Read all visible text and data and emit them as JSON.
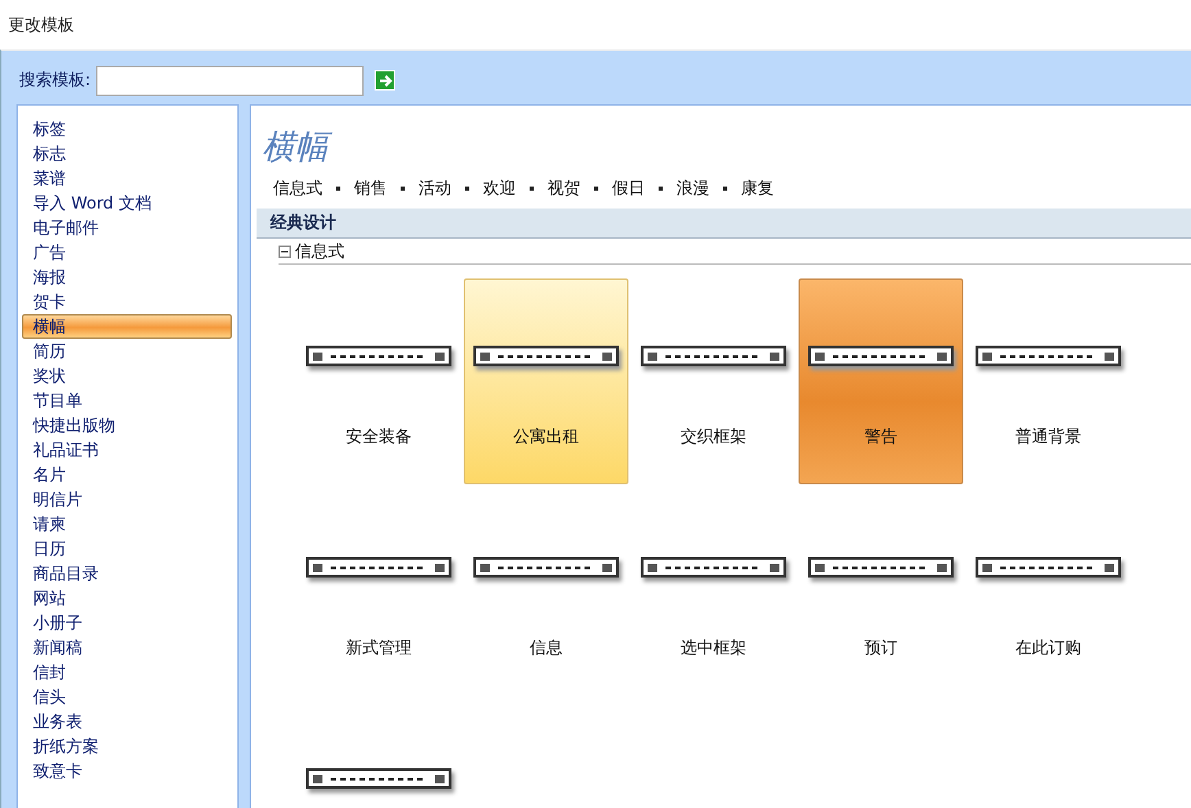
{
  "window": {
    "title": "更改模板"
  },
  "search": {
    "label": "搜索模板:"
  },
  "sidebar": {
    "items": [
      {
        "label": "标签",
        "selected": false
      },
      {
        "label": "标志",
        "selected": false
      },
      {
        "label": "菜谱",
        "selected": false
      },
      {
        "label": "导入 Word 文档",
        "selected": false
      },
      {
        "label": "电子邮件",
        "selected": false
      },
      {
        "label": "广告",
        "selected": false
      },
      {
        "label": "海报",
        "selected": false
      },
      {
        "label": "贺卡",
        "selected": false
      },
      {
        "label": "横幅",
        "selected": true
      },
      {
        "label": "简历",
        "selected": false
      },
      {
        "label": "奖状",
        "selected": false
      },
      {
        "label": "节目单",
        "selected": false
      },
      {
        "label": "快捷出版物",
        "selected": false
      },
      {
        "label": "礼品证书",
        "selected": false
      },
      {
        "label": "名片",
        "selected": false
      },
      {
        "label": "明信片",
        "selected": false
      },
      {
        "label": "请柬",
        "selected": false
      },
      {
        "label": "日历",
        "selected": false
      },
      {
        "label": "商品目录",
        "selected": false
      },
      {
        "label": "网站",
        "selected": false
      },
      {
        "label": "小册子",
        "selected": false
      },
      {
        "label": "新闻稿",
        "selected": false
      },
      {
        "label": "信封",
        "selected": false
      },
      {
        "label": "信头",
        "selected": false
      },
      {
        "label": "业务表",
        "selected": false
      },
      {
        "label": "折纸方案",
        "selected": false
      },
      {
        "label": "致意卡",
        "selected": false
      }
    ]
  },
  "content": {
    "title": "横幅",
    "categories": [
      "信息式",
      "销售",
      "活动",
      "欢迎",
      "视贺",
      "假日",
      "浪漫",
      "康复"
    ],
    "section": "经典设计",
    "group": {
      "label": "信息式",
      "expanded": true
    },
    "templates": [
      {
        "label": "安全装备",
        "selected": false,
        "hovered": false
      },
      {
        "label": "公寓出租",
        "selected": false,
        "hovered": true
      },
      {
        "label": "交织框架",
        "selected": false,
        "hovered": false
      },
      {
        "label": "警告",
        "selected": true,
        "hovered": false
      },
      {
        "label": "普通背景",
        "selected": false,
        "hovered": false
      },
      {
        "label": "新式管理",
        "selected": false,
        "hovered": false
      },
      {
        "label": "信息",
        "selected": false,
        "hovered": false
      },
      {
        "label": "选中框架",
        "selected": false,
        "hovered": false
      },
      {
        "label": "预订",
        "selected": false,
        "hovered": false
      },
      {
        "label": "在此订购",
        "selected": false,
        "hovered": false
      },
      {
        "selected": false,
        "hovered": false
      }
    ]
  }
}
